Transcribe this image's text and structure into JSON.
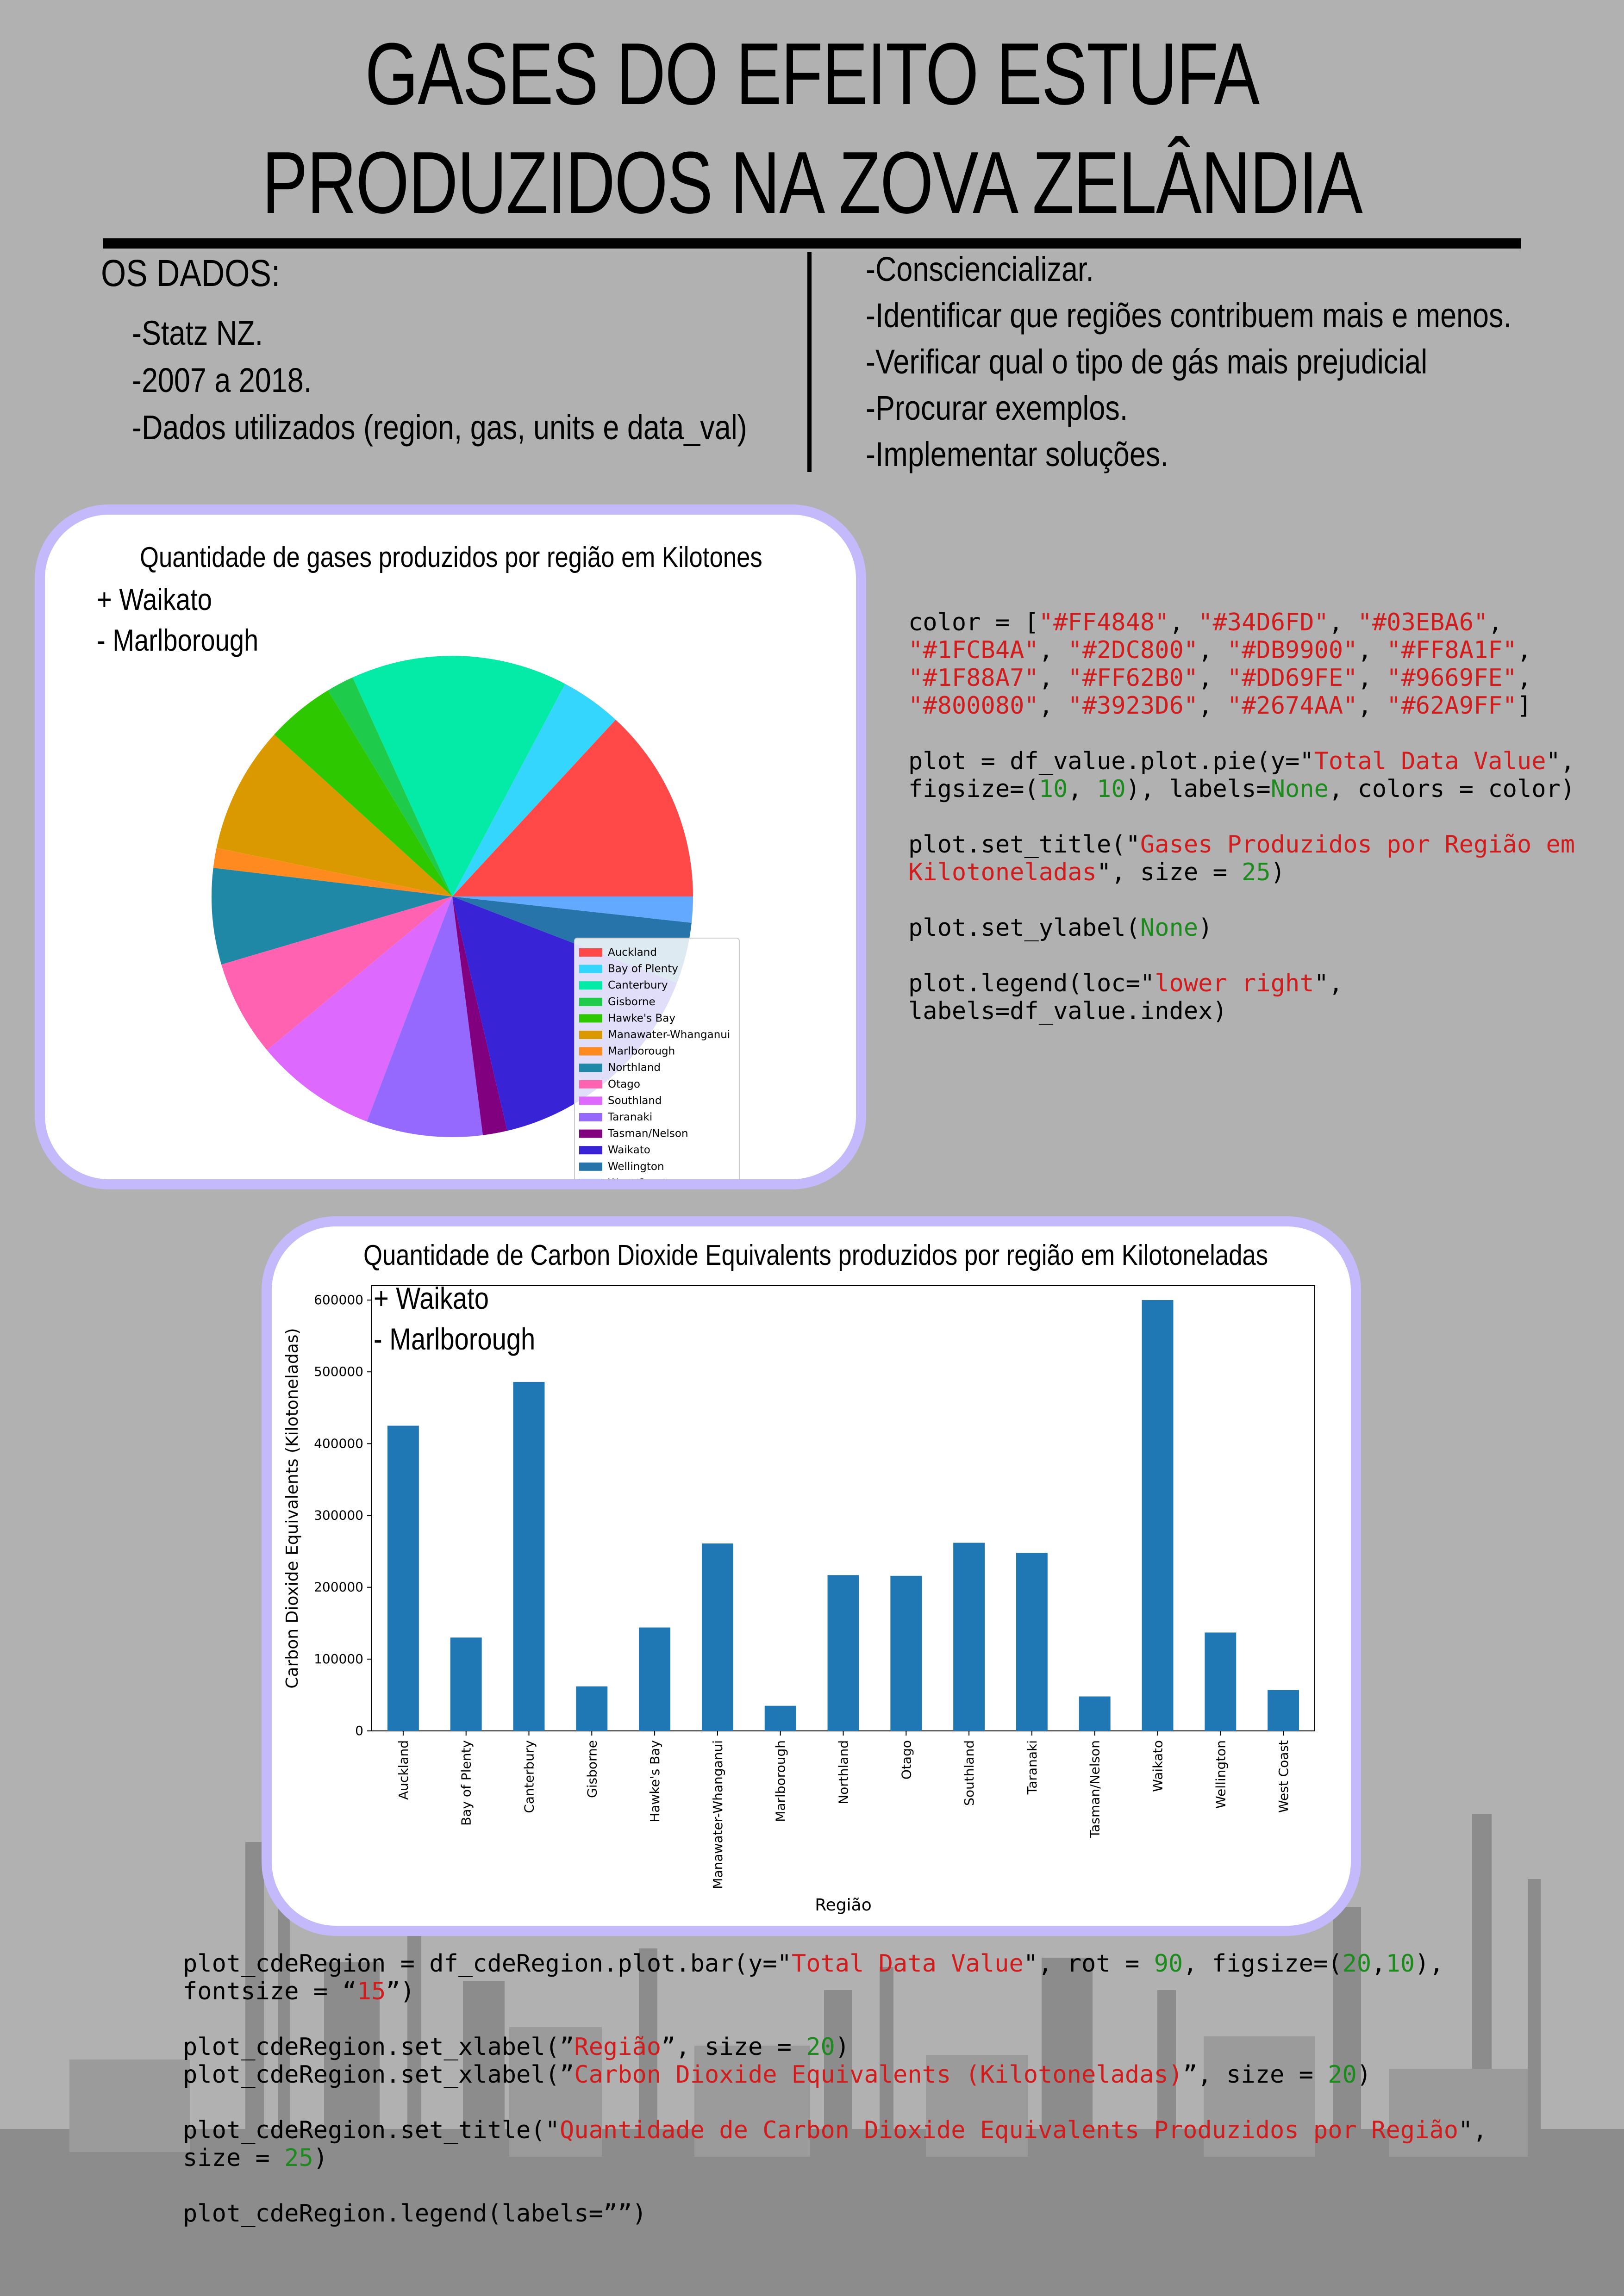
{
  "header": {
    "title_line1": "GASES DO EFEITO ESTUFA",
    "title_line2": "PRODUZIDOS NA ZOVA ZELÂNDIA"
  },
  "data_section": {
    "heading": "OS DADOS:",
    "items": [
      "-Statz NZ.",
      "-2007 a 2018.",
      "-Dados utilizados (region, gas, units e data_val)"
    ]
  },
  "goals": {
    "items": [
      "-Consciencializar.",
      "-Identificar que regiões contribuem mais e menos.",
      "-Verificar qual o tipo de gás mais prejudicial",
      "-Procurar exemplos.",
      "-Implementar soluções."
    ]
  },
  "pie_card": {
    "title": "Quantidade de gases produzidos por região em Kilotones",
    "plus_label": "+ Waikato",
    "minus_label": "- Marlborough"
  },
  "bar_card": {
    "title": "Quantidade de Carbon Dioxide Equivalents produzidos por região em Kilotoneladas",
    "plus_label": "+ Waikato",
    "minus_label": "- Marlborough"
  },
  "code1": {
    "lines": [
      [
        [
          "t",
          "color = ["
        ],
        [
          "s",
          "\"#FF4848\""
        ],
        [
          "t",
          ", "
        ],
        [
          "s",
          "\"#34D6FD\""
        ],
        [
          "t",
          ", "
        ],
        [
          "s",
          "\"#03EBA6\""
        ],
        [
          "t",
          ","
        ]
      ],
      [
        [
          "s",
          "\"#1FCB4A\""
        ],
        [
          "t",
          ", "
        ],
        [
          "s",
          "\"#2DC800\""
        ],
        [
          "t",
          ", "
        ],
        [
          "s",
          "\"#DB9900\""
        ],
        [
          "t",
          ", "
        ],
        [
          "s",
          "\"#FF8A1F\""
        ],
        [
          "t",
          ","
        ]
      ],
      [
        [
          "s",
          "\"#1F88A7\""
        ],
        [
          "t",
          ", "
        ],
        [
          "s",
          "\"#FF62B0\""
        ],
        [
          "t",
          ", "
        ],
        [
          "s",
          "\"#DD69FE\""
        ],
        [
          "t",
          ", "
        ],
        [
          "s",
          "\"#9669FE\""
        ],
        [
          "t",
          ","
        ]
      ],
      [
        [
          "s",
          "\"#800080\""
        ],
        [
          "t",
          ", "
        ],
        [
          "s",
          "\"#3923D6\""
        ],
        [
          "t",
          ", "
        ],
        [
          "s",
          "\"#2674AA\""
        ],
        [
          "t",
          ", "
        ],
        [
          "s",
          "\"#62A9FF\""
        ],
        [
          "t",
          "]"
        ]
      ],
      [],
      [
        [
          "t",
          "plot = df_value.plot.pie(y=\""
        ],
        [
          "s",
          "Total Data Value"
        ],
        [
          "t",
          "\","
        ]
      ],
      [
        [
          "t",
          "figsize=("
        ],
        [
          "n",
          "10"
        ],
        [
          "t",
          ", "
        ],
        [
          "n",
          "10"
        ],
        [
          "t",
          "), labels="
        ],
        [
          "n",
          "None"
        ],
        [
          "t",
          ", colors = color)"
        ]
      ],
      [],
      [
        [
          "t",
          "plot.set_title(\""
        ],
        [
          "s",
          "Gases Produzidos por Região em"
        ]
      ],
      [
        [
          "s",
          "Kilotoneladas"
        ],
        [
          "t",
          "\", size = "
        ],
        [
          "n",
          "25"
        ],
        [
          "t",
          ")"
        ]
      ],
      [],
      [
        [
          "t",
          "plot.set_ylabel("
        ],
        [
          "n",
          "None"
        ],
        [
          "t",
          ")"
        ]
      ],
      [],
      [
        [
          "t",
          "plot.legend(loc=\""
        ],
        [
          "s",
          "lower right"
        ],
        [
          "t",
          "\","
        ]
      ],
      [
        [
          "t",
          "labels=df_value.index)"
        ]
      ]
    ]
  },
  "code2": {
    "lines": [
      [
        [
          "t",
          "plot_cdeRegion = df_cdeRegion.plot.bar(y=\""
        ],
        [
          "s",
          "Total Data Value"
        ],
        [
          "t",
          "\", rot = "
        ],
        [
          "n",
          "90"
        ],
        [
          "t",
          ", figsize=("
        ],
        [
          "n",
          "20"
        ],
        [
          "t",
          ","
        ],
        [
          "n",
          "10"
        ],
        [
          "t",
          "),"
        ]
      ],
      [
        [
          "t",
          "fontsize = “"
        ],
        [
          "s",
          "15"
        ],
        [
          "t",
          "”)"
        ]
      ],
      [],
      [
        [
          "t",
          "plot_cdeRegion.set_xlabel(”"
        ],
        [
          "s",
          "Região"
        ],
        [
          "t",
          "”, size = "
        ],
        [
          "n",
          "20"
        ],
        [
          "t",
          ")"
        ]
      ],
      [
        [
          "t",
          "plot_cdeRegion.set_xlabel(”"
        ],
        [
          "s",
          "Carbon Dioxide Equivalents (Kilotoneladas)"
        ],
        [
          "t",
          "”, size = "
        ],
        [
          "n",
          "20"
        ],
        [
          "t",
          ")"
        ]
      ],
      [],
      [
        [
          "t",
          "plot_cdeRegion.set_title(\""
        ],
        [
          "s",
          "Quantidade de Carbon Dioxide Equivalents Produzidos por Região"
        ],
        [
          "t",
          "\","
        ]
      ],
      [
        [
          "t",
          "size = "
        ],
        [
          "n",
          "25"
        ],
        [
          "t",
          ")"
        ]
      ],
      [],
      [
        [
          "t",
          "plot_cdeRegion.legend(labels=””)"
        ]
      ]
    ]
  },
  "chart_data": [
    {
      "type": "pie",
      "title": "",
      "categories": [
        "Auckland",
        "Bay of Plenty",
        "Canterbury",
        "Gisborne",
        "Hawke's Bay",
        "Manawater-Whanganui",
        "Marlborough",
        "Northland",
        "Otago",
        "Southland",
        "Taranaki",
        "Tasman/Nelson",
        "Waikato",
        "Wellington",
        "West Coast"
      ],
      "values": [
        12.8,
        4.0,
        14.2,
        1.8,
        4.5,
        8.3,
        1.3,
        6.3,
        6.3,
        8.0,
        7.6,
        1.6,
        15.1,
        4.0,
        1.7
      ],
      "colors": [
        "#FF4848",
        "#34D6FD",
        "#03EBA6",
        "#1FCB4A",
        "#2DC800",
        "#DB9900",
        "#FF8A1F",
        "#1F88A7",
        "#FF62B0",
        "#DD69FE",
        "#9669FE",
        "#800080",
        "#3923D6",
        "#2674AA",
        "#62A9FF"
      ],
      "legend_position": "lower right"
    },
    {
      "type": "bar",
      "title": "",
      "categories": [
        "Auckland",
        "Bay of Plenty",
        "Canterbury",
        "Gisborne",
        "Hawke's Bay",
        "Manawater-Whanganui",
        "Marlborough",
        "Northland",
        "Otago",
        "Southland",
        "Taranaki",
        "Tasman/Nelson",
        "Waikato",
        "Wellington",
        "West Coast"
      ],
      "values": [
        425000,
        130000,
        486000,
        62000,
        144000,
        261000,
        35000,
        217000,
        216000,
        262000,
        248000,
        48000,
        600000,
        137000,
        57000
      ],
      "xlabel": "Região",
      "ylabel": "Carbon Dioxide Equivalents (Kilotoneladas)",
      "ylim": [
        0,
        620000
      ],
      "yticks": [
        0,
        100000,
        200000,
        300000,
        400000,
        500000,
        600000
      ],
      "color": "#1F77B4"
    }
  ]
}
